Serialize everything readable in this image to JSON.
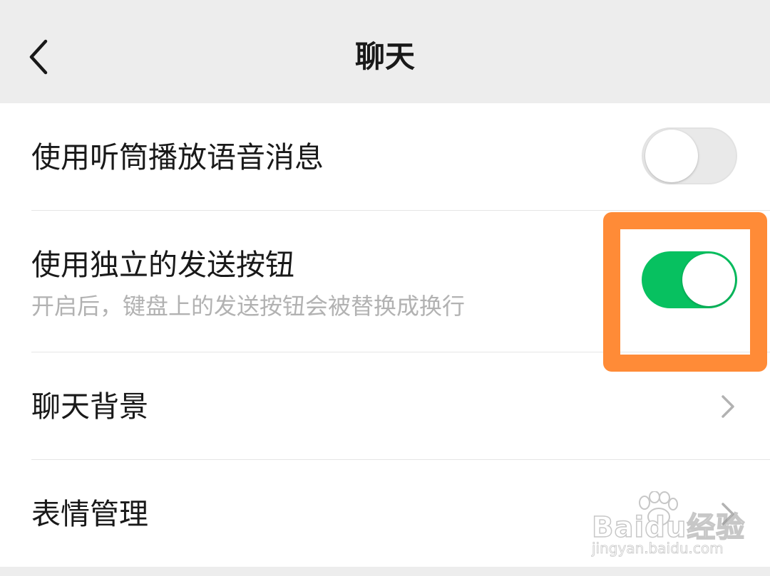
{
  "header": {
    "title": "聊天",
    "back_icon": "chevron-left-icon"
  },
  "settings": [
    {
      "label": "使用听筒播放语音消息",
      "control": "toggle",
      "on": false
    },
    {
      "label": "使用独立的发送按钮",
      "description": "开启后，键盘上的发送按钮会被替换成换行",
      "control": "toggle",
      "on": true
    },
    {
      "label": "聊天背景",
      "control": "chevron-right-icon"
    },
    {
      "label": "表情管理",
      "control": "chevron-right-icon"
    }
  ],
  "colors": {
    "background": "#ededed",
    "toggle_on": "#07c160",
    "toggle_off": "#e9e9e9",
    "highlight": "#ff8b37",
    "secondary_text": "#b2b2b2"
  },
  "watermark": {
    "logo": "Baidu经验",
    "url": "jingyan.baidu.com"
  }
}
